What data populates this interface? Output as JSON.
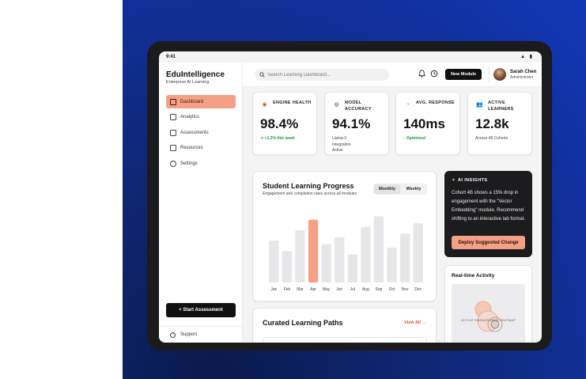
{
  "status_bar": {
    "time": "9:41",
    "icons": "▲ ▮"
  },
  "sidebar": {
    "brand": "EduIntelligence",
    "subtitle": "Enterprise AI Learning",
    "items": [
      {
        "label": "Dashboard",
        "icon": "grid-icon",
        "active": true
      },
      {
        "label": "Analytics",
        "icon": "chart-icon",
        "active": false
      },
      {
        "label": "Assessments",
        "icon": "clipboard-icon",
        "active": false
      },
      {
        "label": "Resources",
        "icon": "book-icon",
        "active": false
      },
      {
        "label": "Settings",
        "icon": "gear-icon",
        "active": false
      }
    ],
    "start_button": "+ Start Assessment",
    "support": "Support"
  },
  "topbar": {
    "search_placeholder": "Search Learning Dashboard...",
    "new_module": "New Module",
    "user_name": "Sarah Chen",
    "user_role": "Administrator"
  },
  "kpis": [
    {
      "label": "ENGINE HEALTH",
      "value": "98.4%",
      "sub": "↗ +1.2% this week",
      "sub_style": "green",
      "icon": "target-icon",
      "icon_color": "#d9542b"
    },
    {
      "label": "MODEL ACCURACY",
      "value": "94.1%",
      "sub": "Llama-3 Integration Active",
      "sub_style": "plain",
      "icon": "brain-icon",
      "icon_color": "#111111"
    },
    {
      "label": "AVG. RESPONSE",
      "value": "140ms",
      "sub": "↓ Optimized",
      "sub_style": "green",
      "icon": "speedometer-icon",
      "icon_color": "#d9542b"
    },
    {
      "label": "ACTIVE LEARNERS",
      "value": "12.8k",
      "sub": "Across 48 Cohorts",
      "sub_style": "plain",
      "icon": "users-icon",
      "icon_color": "#111111"
    }
  ],
  "progress": {
    "title": "Student Learning Progress",
    "subtitle": "Engagement and completion rates across all modules",
    "toggle": [
      "Monthly",
      "Weekly"
    ],
    "selected": "Monthly"
  },
  "chart_data": {
    "type": "bar",
    "categories": [
      "Jan",
      "Feb",
      "Mar",
      "Apr",
      "May",
      "Jun",
      "Jul",
      "Aug",
      "Sep",
      "Oct",
      "Nov",
      "Dec"
    ],
    "values": [
      60,
      45,
      75,
      90,
      55,
      65,
      40,
      80,
      95,
      50,
      70,
      85
    ],
    "highlight_index": 3,
    "highlight_color": "#f4a084",
    "bar_color": "#e6e6e8",
    "ylim": [
      0,
      100
    ],
    "grid": false,
    "title": "",
    "xlabel": "",
    "ylabel": ""
  },
  "insights": {
    "title": "AI INSIGHTS",
    "text": "Cohort 4B shows a 15% drop in engagement with the \"Vector Embedding\" module. Recommend shifting to an interactive lab format.",
    "button": "Deploy Suggested Change"
  },
  "realtime": {
    "title": "Real-time Activity",
    "heatmap_label": "ACTIVE ENGAGEMENT HEATMAP"
  },
  "curated": {
    "title": "Curated Learning Paths",
    "view_all": "View All →"
  },
  "colors": {
    "accent": "#f4a084",
    "accent_text": "#d9542b",
    "dark": "#1c1c1e",
    "green": "#1a9a3a"
  }
}
